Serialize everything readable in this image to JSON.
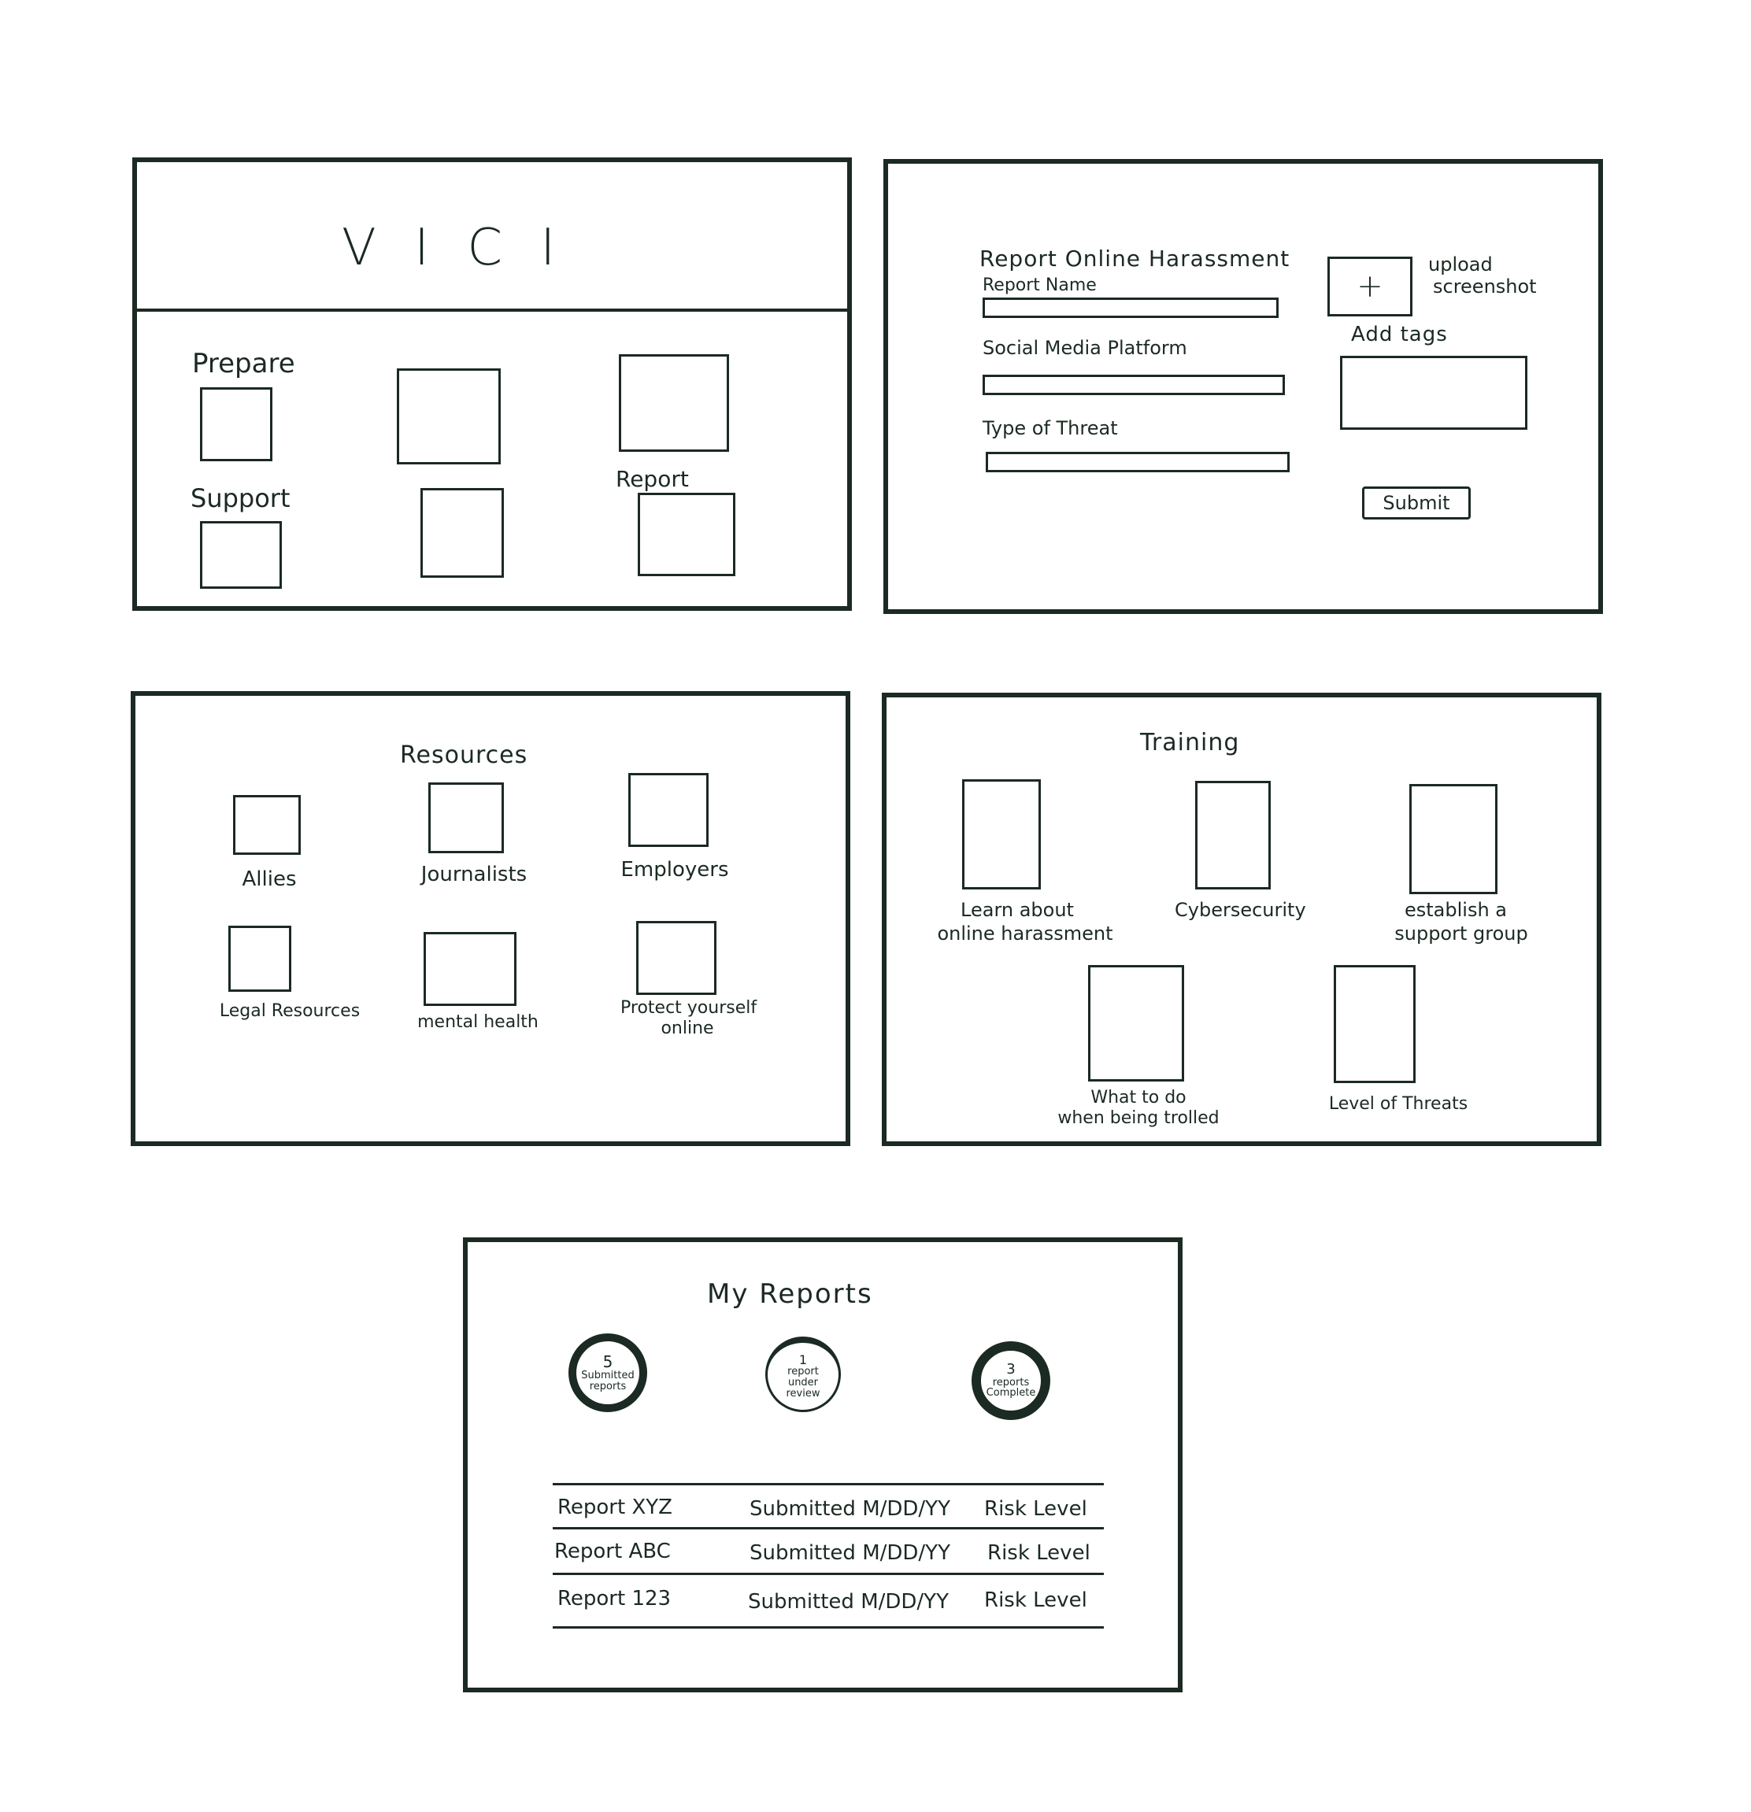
{
  "home": {
    "title": "V I C I",
    "prepare_label": "Prepare",
    "support_label": "Support",
    "report_label": "Report"
  },
  "report_form": {
    "heading": "Report Online Harassment",
    "name_label": "Report Name",
    "platform_label": "Social Media Platform",
    "threat_label": "Type of Threat",
    "upload_icon_glyph": "+",
    "upload_label_line1": "upload",
    "upload_label_line2": "screenshot",
    "tags_label": "Add tags",
    "submit_label": "Submit"
  },
  "resources": {
    "heading": "Resources",
    "items": [
      {
        "label": "Allies"
      },
      {
        "label": "Journalists"
      },
      {
        "label": "Employers"
      },
      {
        "label": "Legal Resources"
      },
      {
        "label": "mental health"
      },
      {
        "label_line1": "Protect yourself",
        "label_line2": "online"
      }
    ]
  },
  "training": {
    "heading": "Training",
    "items": [
      {
        "label_line1": "Learn about",
        "label_line2": "online harassment"
      },
      {
        "label_line1": "Cybersecurity"
      },
      {
        "label_line1": "establish a",
        "label_line2": "support group"
      },
      {
        "label_line1": "What to do",
        "label_line2": "when being trolled"
      },
      {
        "label_line1": "Level of Threats"
      }
    ]
  },
  "my_reports": {
    "heading": "My Reports",
    "stats": [
      {
        "number": "5",
        "line1": "Submitted",
        "line2": "reports"
      },
      {
        "number": "1",
        "line1": "report",
        "line2": "under",
        "line3": "review"
      },
      {
        "number": "3",
        "line1": "reports",
        "line2": "Complete"
      }
    ],
    "rows": [
      {
        "name": "Report XYZ",
        "submitted": "Submitted M/DD/YY",
        "risk": "Risk Level"
      },
      {
        "name": "Report ABC",
        "submitted": "Submitted M/DD/YY",
        "risk": "Risk Level"
      },
      {
        "name": "Report 123",
        "submitted": "Submitted M/DD/YY",
        "risk": "Risk Level"
      }
    ]
  }
}
